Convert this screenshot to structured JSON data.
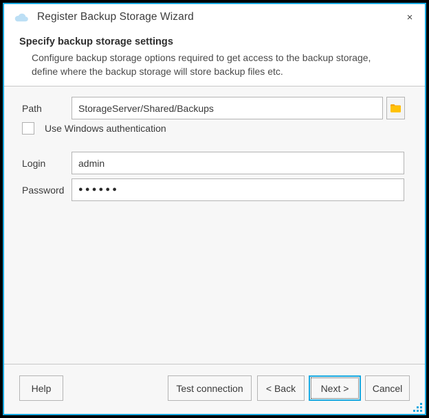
{
  "window": {
    "title": "Register Backup Storage Wizard",
    "icon": "cloud-icon",
    "close_label": "×",
    "accent_color": "#17a8e0",
    "frame_color": "#000000",
    "titlebar_background": "#ffffff",
    "body_background": "#f7f7f7"
  },
  "header": {
    "title": "Specify backup storage settings",
    "description_line1": "Configure backup storage options required to get access to the backup storage,",
    "description_line2": "define where the backup storage will store backup files etc."
  },
  "form": {
    "path": {
      "label": "Path",
      "value": "StorageServer/Shared/Backups",
      "placeholder": "",
      "browse_icon": "folder-icon",
      "browse_icon_color": "#ffc107",
      "browse_icon_tab_color": "#f5a300"
    },
    "windows_auth": {
      "label": "Use Windows authentication",
      "checked": false
    },
    "login": {
      "label": "Login",
      "value": "admin",
      "placeholder": ""
    },
    "password": {
      "label": "Password",
      "value": "●●●●●●",
      "masked_length": 6,
      "placeholder": ""
    }
  },
  "footer": {
    "help": "Help",
    "test_connection": "Test connection",
    "back": "< Back",
    "next": "Next >",
    "cancel": "Cancel",
    "focused_button": "next"
  }
}
